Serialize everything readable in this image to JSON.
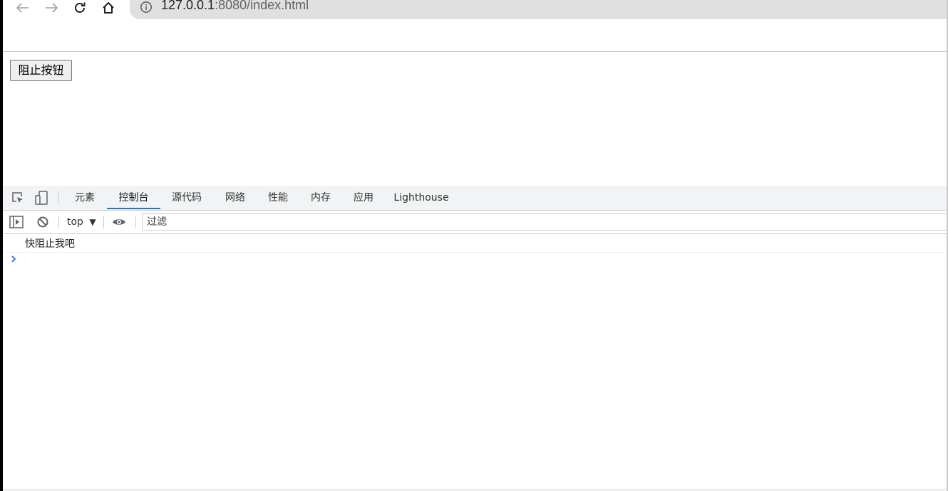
{
  "browser": {
    "url_host": "127.0.0.1",
    "url_rest": ":8080/index.html"
  },
  "page": {
    "button_label": "阻止按钮"
  },
  "devtools": {
    "tabs": [
      {
        "label": "元素"
      },
      {
        "label": "控制台"
      },
      {
        "label": "源代码"
      },
      {
        "label": "网络"
      },
      {
        "label": "性能"
      },
      {
        "label": "内存"
      },
      {
        "label": "应用"
      },
      {
        "label": "Lighthouse"
      }
    ],
    "active_tab": "控制台",
    "context": "top",
    "filter_placeholder": "过滤",
    "log_messages": [
      "快阻止我吧"
    ]
  },
  "colors": {
    "accent": "#1a73e8",
    "prompt": "#1a73e8"
  }
}
